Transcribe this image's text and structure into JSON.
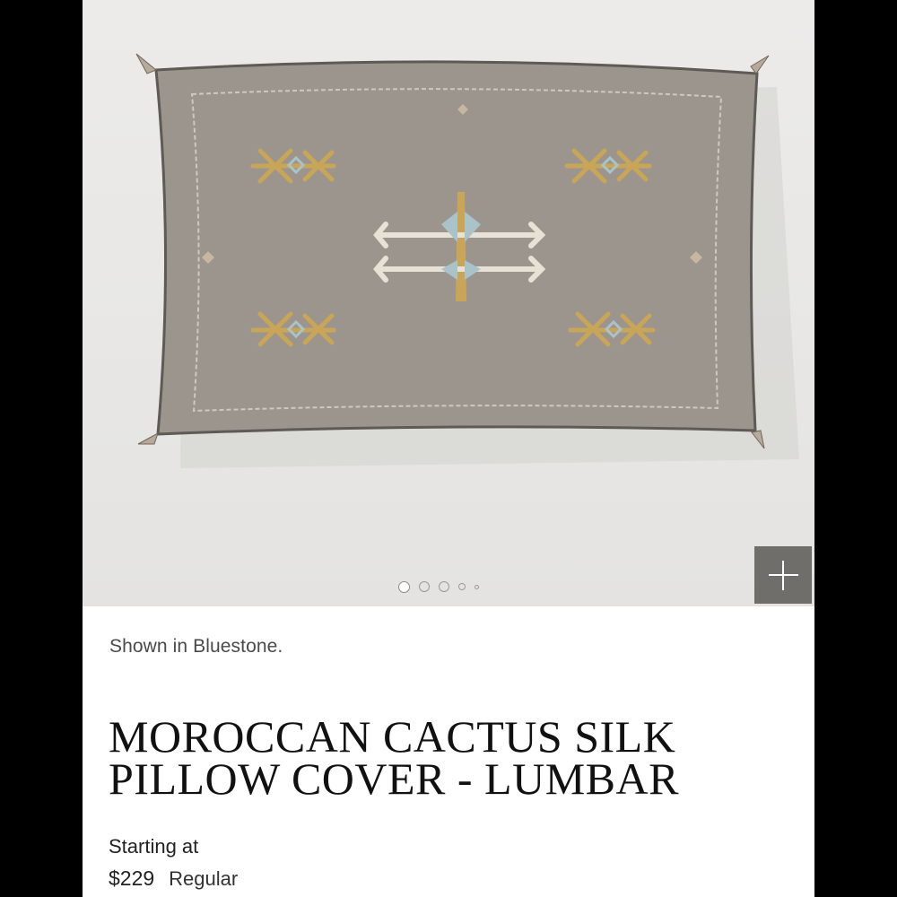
{
  "product": {
    "image_caption": "Shown in Bluestone.",
    "title": "MOROCCAN CACTUS SILK PILLOW COVER - LUMBAR",
    "price_prefix": "Starting at",
    "price": "$229",
    "price_type": "Regular"
  },
  "gallery": {
    "dot_count": 5,
    "active_dot": 1,
    "zoom_icon": "plus-icon"
  },
  "colors": {
    "pillow": "#9a948c",
    "embroidery_gold": "#c9a657",
    "embroidery_blue": "#a9c3c8",
    "zoom_button_bg": "#6f6e6b"
  }
}
